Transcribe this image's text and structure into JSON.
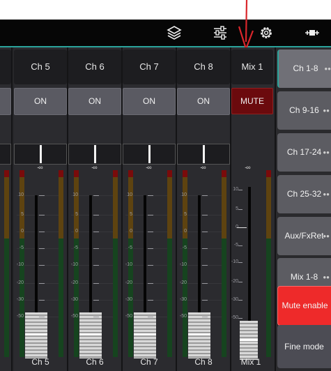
{
  "toolbar": {
    "icons": [
      "layers-icon",
      "sliders-icon",
      "gear-icon",
      "connector-icon"
    ]
  },
  "channels": [
    {
      "label": "Ch 5",
      "button": "ON",
      "level": "-∞",
      "bottom": "Ch 5"
    },
    {
      "label": "Ch 6",
      "button": "ON",
      "level": "-∞",
      "bottom": "Ch 6"
    },
    {
      "label": "Ch 7",
      "button": "ON",
      "level": "-∞",
      "bottom": "Ch 7"
    },
    {
      "label": "Ch 8",
      "button": "ON",
      "level": "-∞",
      "bottom": "Ch 8"
    }
  ],
  "mix": {
    "label": "Mix 1",
    "button": "MUTE",
    "level": "-∞",
    "bottom": "Mix 1"
  },
  "scale_labels": [
    "10",
    "5",
    "0",
    "-5",
    "-10",
    "-20",
    "-30",
    "-50"
  ],
  "mix_scale_labels": [
    "10",
    "5",
    "0",
    "-5",
    "-10",
    "-20",
    "-30",
    "-50"
  ],
  "side_menu": {
    "items": [
      "Ch 1-8",
      "Ch 9-16",
      "Ch 17-24",
      "Ch 25-32",
      "Aux/FxRet",
      "Mix 1-8"
    ],
    "selected": "Ch 1-8",
    "mute_enable": "Mute enable",
    "fine_mode": "Fine mode"
  },
  "colors": {
    "accent": "#2aa39b",
    "mute_active": "#6b0a0d",
    "mute_enable": "#ee2a2a",
    "annotation_arrow": "#d9262b"
  }
}
